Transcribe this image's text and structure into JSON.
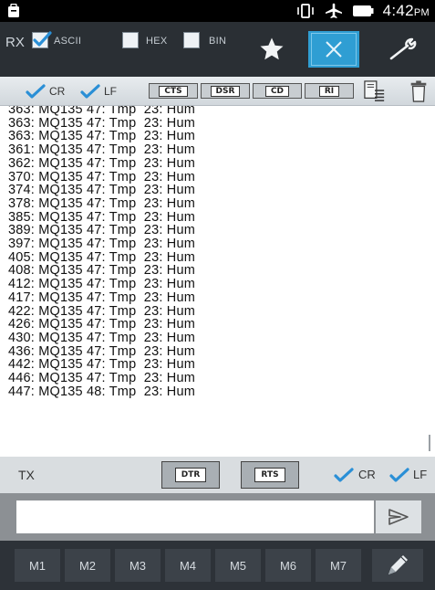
{
  "status_bar": {
    "time": "4:42",
    "ampm": "PM"
  },
  "rx_toolbar": {
    "label": "RX",
    "options": [
      {
        "label": "ASCII",
        "checked": true
      },
      {
        "label": "HEX",
        "checked": false
      },
      {
        "label": "BIN",
        "checked": false
      }
    ],
    "buttons": [
      "star-icon",
      "close-icon",
      "wrench-icon"
    ],
    "active_button": "close-icon"
  },
  "signals_bar": {
    "cr_label": "CR",
    "lf_label": "LF",
    "cr_checked": true,
    "lf_checked": true,
    "indicators": [
      "CTS",
      "DSR",
      "CD",
      "RI"
    ]
  },
  "terminal": {
    "lines": [
      "363: MQ135 47: Tmp  23: Hum",
      "363: MQ135 47: Tmp  23: Hum",
      "363: MQ135 47: Tmp  23: Hum",
      "361: MQ135 47: Tmp  23: Hum",
      "362: MQ135 47: Tmp  23: Hum",
      "370: MQ135 47: Tmp  23: Hum",
      "374: MQ135 47: Tmp  23: Hum",
      "378: MQ135 47: Tmp  23: Hum",
      "385: MQ135 47: Tmp  23: Hum",
      "389: MQ135 47: Tmp  23: Hum",
      "397: MQ135 47: Tmp  23: Hum",
      "405: MQ135 47: Tmp  23: Hum",
      "408: MQ135 47: Tmp  23: Hum",
      "412: MQ135 47: Tmp  23: Hum",
      "417: MQ135 47: Tmp  23: Hum",
      "422: MQ135 47: Tmp  23: Hum",
      "426: MQ135 47: Tmp  23: Hum",
      "430: MQ135 47: Tmp  23: Hum",
      "436: MQ135 47: Tmp  23: Hum",
      "442: MQ135 47: Tmp  23: Hum",
      "446: MQ135 47: Tmp  23: Hum",
      "447: MQ135 48: Tmp  23: Hum"
    ]
  },
  "tx_bar": {
    "label": "TX",
    "controls": [
      "DTR",
      "RTS"
    ],
    "cr_label": "CR",
    "lf_label": "LF",
    "cr_checked": true,
    "lf_checked": true
  },
  "input": {
    "value": "",
    "placeholder": ""
  },
  "macros": [
    "M1",
    "M2",
    "M3",
    "M4",
    "M5",
    "M6",
    "M7"
  ],
  "colors": {
    "accent": "#2f9ed3",
    "check": "#2a8fd6",
    "toolbar": "#2a2f34"
  }
}
